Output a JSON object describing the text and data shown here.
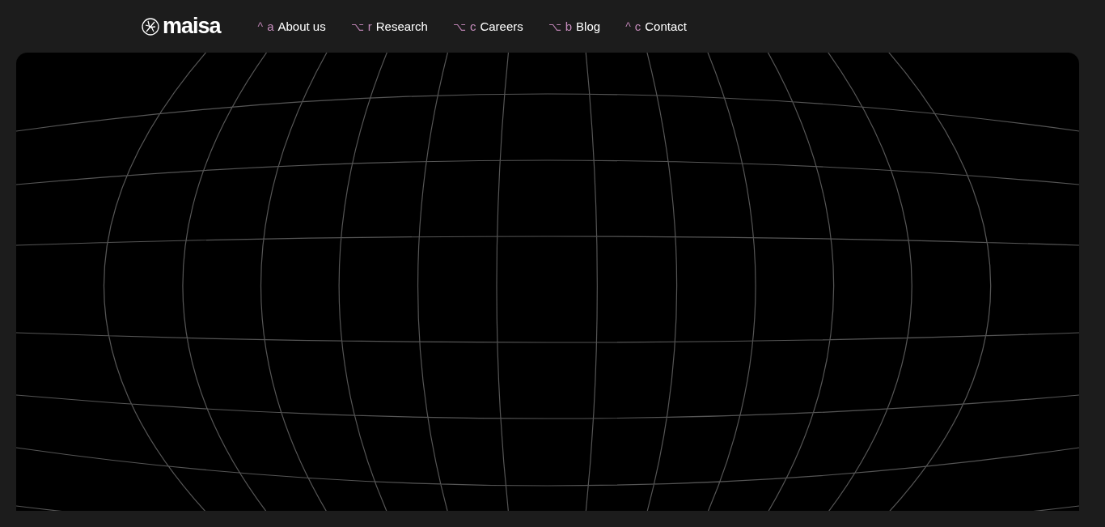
{
  "logo": {
    "text": "maisa"
  },
  "nav": [
    {
      "modifier": "^",
      "key": "a",
      "label": "About us"
    },
    {
      "modifier": "⌥",
      "key": "r",
      "label": "Research"
    },
    {
      "modifier": "⌥",
      "key": "c",
      "label": "Careers"
    },
    {
      "modifier": "⌥",
      "key": "b",
      "label": "Blog"
    },
    {
      "modifier": "^",
      "key": "c",
      "label": "Contact"
    }
  ]
}
